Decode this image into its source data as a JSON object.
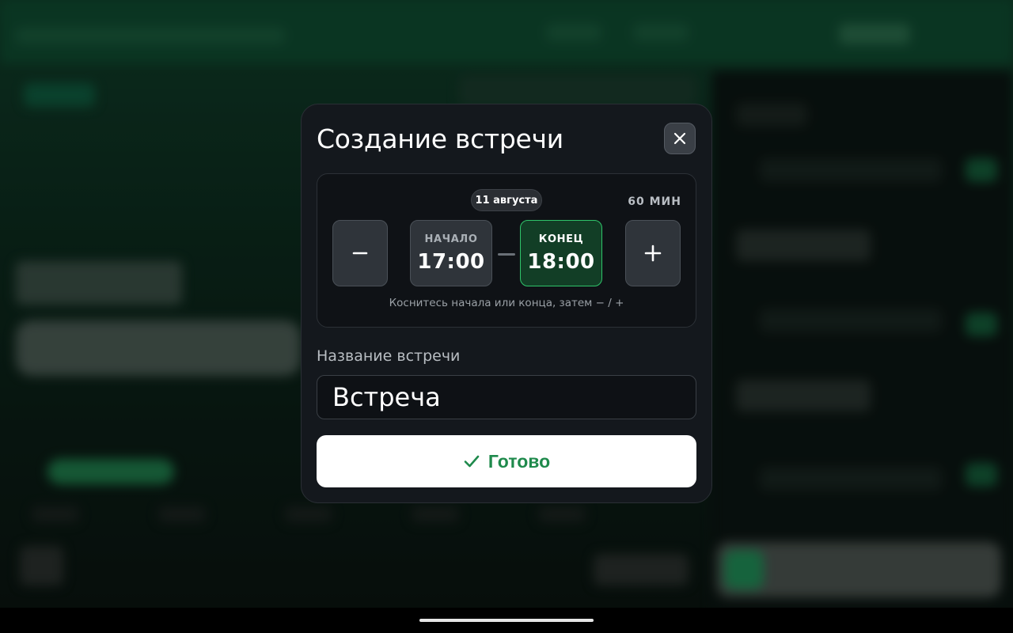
{
  "dialog": {
    "title": "Создание встречи",
    "close_icon": "close-icon"
  },
  "time_range": {
    "date": "11 августа",
    "duration": "60 МИН",
    "start_label": "НАЧАЛО",
    "start_time": "17:00",
    "end_label": "КОНЕЦ",
    "end_time": "18:00",
    "selected": "end",
    "decrement_icon": "minus-icon",
    "increment_icon": "plus-icon",
    "hint": "Коснитесь начала или конца, затем − / +"
  },
  "meeting_name": {
    "label": "Название встречи",
    "value": "Встреча"
  },
  "done_button": {
    "label": "Готово",
    "icon": "check-icon"
  },
  "colors": {
    "accent_green": "#1f8a4c",
    "selected_border": "#2fc46a",
    "dialog_bg": "#14181d"
  }
}
